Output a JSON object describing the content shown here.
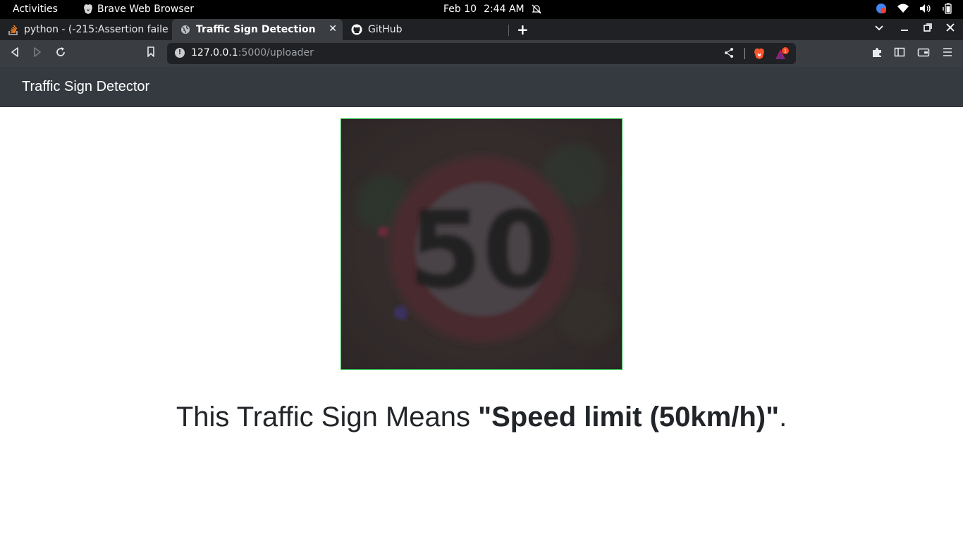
{
  "system": {
    "activities": "Activities",
    "app_name": "Brave Web Browser",
    "date": "Feb 10",
    "time": "2:44 AM"
  },
  "tabs": [
    {
      "title": "python - (-215:Assertion failed",
      "active": false,
      "icon": "stackoverflow-icon"
    },
    {
      "title": "Traffic Sign Detection",
      "active": true,
      "icon": "globe-icon"
    },
    {
      "title": "GitHub",
      "active": false,
      "icon": "github-icon"
    }
  ],
  "address": {
    "host": "127.0.0.1",
    "path": ":5000/uploader",
    "rewards_badge": "1"
  },
  "page": {
    "brand": "Traffic Sign Detector",
    "sign_number": "50",
    "result_prefix": "This Traffic Sign Means ",
    "result_value": "\"Speed limit (50km/h)\"",
    "result_suffix": "."
  },
  "colors": {
    "navbar": "#343a40",
    "image_border": "#2fbf4f",
    "text": "#212529"
  }
}
